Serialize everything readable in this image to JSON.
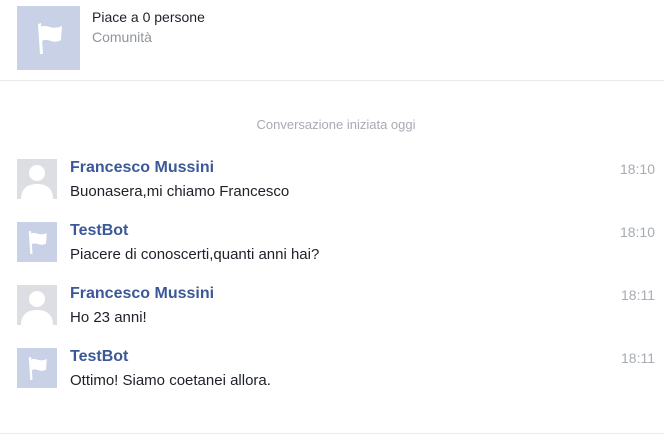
{
  "page": {
    "likes": "Piace a 0 persone",
    "category": "Comunità",
    "avatar_icon": "flag-icon"
  },
  "conversation": {
    "started_label": "Conversazione iniziata oggi",
    "messages": [
      {
        "sender": "Francesco Mussini",
        "text": "Buonasera,mi chiamo Francesco",
        "time": "18:10",
        "avatar": "user-silhouette-icon"
      },
      {
        "sender": "TestBot",
        "text": "Piacere di conoscerti,quanti anni hai?",
        "time": "18:10",
        "avatar": "flag-icon"
      },
      {
        "sender": "Francesco Mussini",
        "text": "Ho 23 anni!",
        "time": "18:11",
        "avatar": "user-silhouette-icon"
      },
      {
        "sender": "TestBot",
        "text": "Ottimo! Siamo coetanei allora.",
        "time": "18:11",
        "avatar": "flag-icon"
      }
    ]
  },
  "colors": {
    "sender_name": "#3b5998",
    "page_avatar_bg": "#c8d1e6",
    "user_avatar_bg": "#dcdee3"
  }
}
